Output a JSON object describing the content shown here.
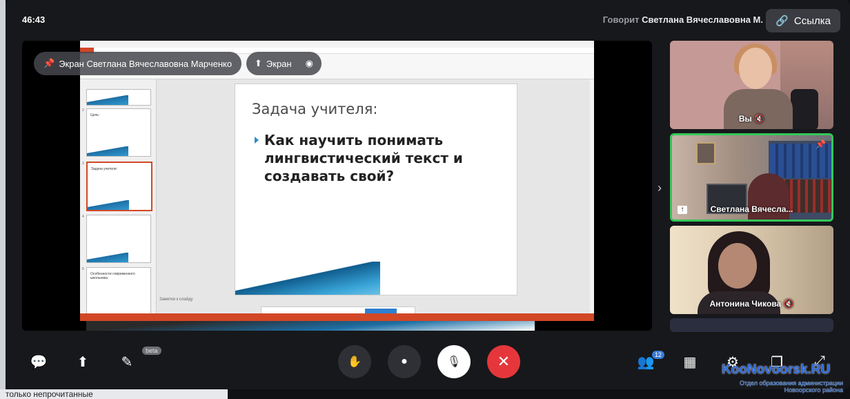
{
  "header": {
    "timer": "46:43",
    "speaking_prefix": "Говорит",
    "speaking_name": "Светлана Вячеславовна М.",
    "link_label": "Ссылка"
  },
  "screen_share": {
    "pin_label": "Экран Светлана Вячеславовна Марченко",
    "screen_button": "Экран"
  },
  "slide": {
    "title": "Задача учителя:",
    "bullet": "Как научить понимать лингвистический текст и создавать свой?",
    "notes_label": "Заметки к слайду"
  },
  "thumbnails": [
    {
      "num": "2",
      "text": "Цель:"
    },
    {
      "num": "3",
      "text": "Задача учителя:"
    },
    {
      "num": "4",
      "text": ""
    },
    {
      "num": "5",
      "text": "Особенности современного школьника"
    }
  ],
  "participants": [
    {
      "name": "Вы",
      "mic": "muted"
    },
    {
      "name": "Светлана Вячесла...",
      "mic": "on"
    },
    {
      "name": "Антонина Чикова",
      "mic": "muted"
    }
  ],
  "toolbar": {
    "beta_badge": "beta",
    "participants_count": "12"
  },
  "background": {
    "unread_text": "только непрочитанные"
  },
  "watermark": {
    "site": "KooNovoorsk.RU",
    "subtitle": "Отдел образования администрации Новоорского района"
  },
  "colors": {
    "end_call": "#e5373b",
    "active_speaker_border": "#34c759",
    "powerpoint_accent": "#d24726"
  }
}
